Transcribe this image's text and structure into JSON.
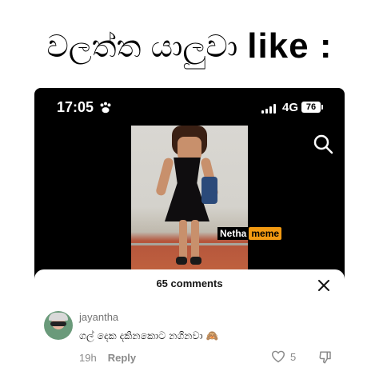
{
  "headline": {
    "sinhala": "වලත්ත යාලුවා",
    "english": "like :"
  },
  "status_bar": {
    "time": "17:05",
    "network": "4G",
    "battery": "76"
  },
  "watermark": {
    "part1": "Netha",
    "part2": "meme"
  },
  "comments_sheet": {
    "title": "65 comments",
    "comment": {
      "username": "jayantha",
      "text": "ගල් දෙක දකිනකොට නගිනවා 🙈",
      "time": "19h",
      "reply_label": "Reply",
      "like_count": "5"
    }
  },
  "colors": {
    "accent_orange": "#f29a12",
    "muted_text": "#8a8a8a",
    "phone_bg": "#000000"
  }
}
